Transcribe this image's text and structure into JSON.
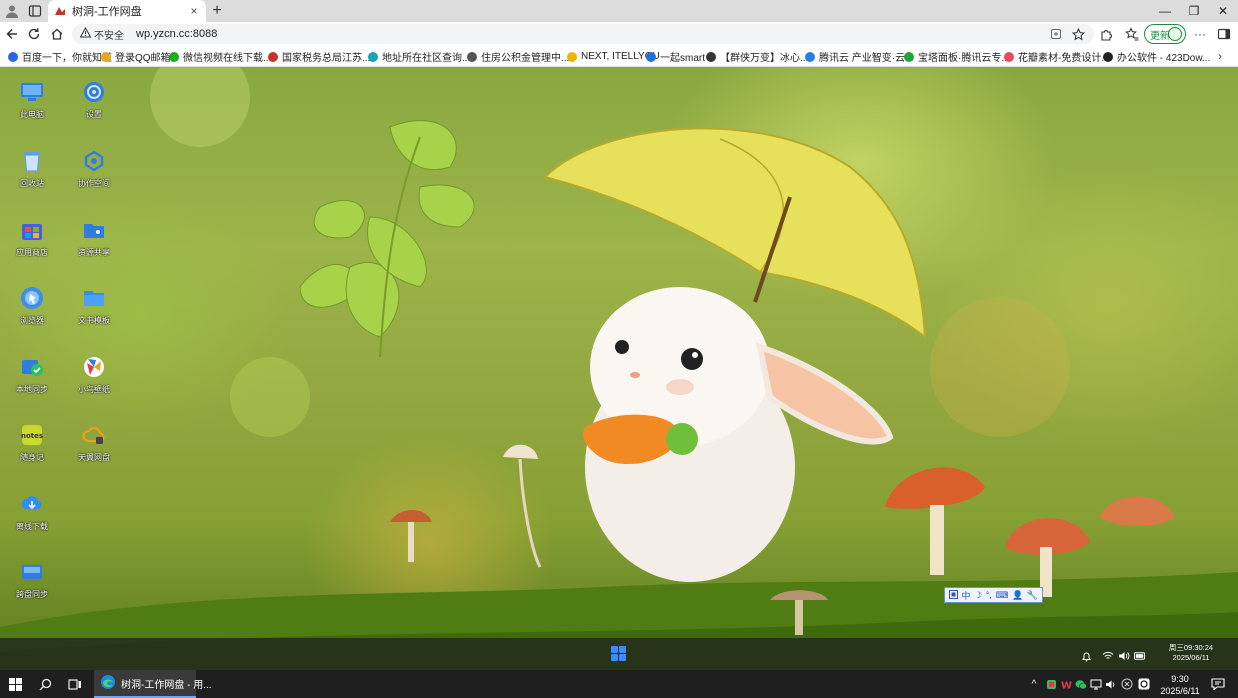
{
  "browser": {
    "tab": {
      "title": "树洞-工作网盘",
      "close_glyph": "×"
    },
    "new_tab_glyph": "+",
    "window_controls": {
      "minimize": "—",
      "restore": "❐",
      "close": "✕"
    },
    "address": {
      "security_label": "不安全",
      "url": "wp.yzcn.cc:8088"
    },
    "update_button": "更新",
    "menu_glyph": "···",
    "bookmarks": [
      {
        "label": "百度一下，你就知道",
        "color": "#2d63e6"
      },
      {
        "label": "登录QQ邮箱",
        "color": "#e8a61e"
      },
      {
        "label": "微信视频在线下载...",
        "color": "#1aad19"
      },
      {
        "label": "国家税务总局江苏...",
        "color": "#c8332b"
      },
      {
        "label": "地址所在社区查询...",
        "color": "#17a2b8"
      },
      {
        "label": "住房公积金管理中...",
        "color": "#555555"
      },
      {
        "label": "NEXT, ITELLYOU",
        "color": "#f0b400"
      },
      {
        "label": "一起smart",
        "color": "#1e73d8"
      },
      {
        "label": "【群侠万变】冰心...",
        "color": "#333333"
      },
      {
        "label": "腾讯云 产业智变·云...",
        "color": "#2b7de9"
      },
      {
        "label": "宝塔面板·腾讯云专...",
        "color": "#20a53a"
      },
      {
        "label": "花瓣素材-免费设计...",
        "color": "#e84b5f"
      },
      {
        "label": "办公软件 - 423Dow...",
        "color": "#222222"
      }
    ]
  },
  "desktop": {
    "icons": [
      {
        "label": "此电脑",
        "icon": "computer-icon",
        "color": "#2f7de1"
      },
      {
        "label": "设置",
        "icon": "gear-icon",
        "color": "#2f7de1"
      },
      {
        "label": "回收站",
        "icon": "recycle-bin-icon",
        "color": "#5aa0ea"
      },
      {
        "label": "协作空间",
        "icon": "collaboration-icon",
        "color": "#2f7de1"
      },
      {
        "label": "应用商店",
        "icon": "app-store-icon",
        "color": "#4a5ce6"
      },
      {
        "label": "资源共享",
        "icon": "share-folder-icon",
        "color": "#2f7de1"
      },
      {
        "label": "浏览器",
        "icon": "browser-icon",
        "color": "#3a8ef0"
      },
      {
        "label": "文书模板",
        "icon": "folder-icon",
        "color": "#2f8ef0"
      },
      {
        "label": "本地同步",
        "icon": "local-sync-icon",
        "color": "#2f7de1"
      },
      {
        "label": "小鸟壁纸",
        "icon": "bird-wallpaper-icon",
        "color": "#e13b3b"
      },
      {
        "label": "随身记",
        "icon": "notes-icon",
        "color": "#c9d92e"
      },
      {
        "label": "天翼网盘",
        "icon": "cloud-drive-icon",
        "color": "#f0a020"
      },
      {
        "label": "离线下载",
        "icon": "offline-download-icon",
        "color": "#2f8ef0"
      },
      {
        "label": "跨盘同步",
        "icon": "cross-drive-sync-icon",
        "color": "#2f7de1"
      }
    ],
    "inner_taskbar": {
      "clock_line1": "周三09:30:24",
      "clock_line2": "2025/06/11",
      "ime_items": [
        "中",
        "☽",
        "°,",
        "⌨",
        "👤",
        "🔧"
      ]
    }
  },
  "taskbar": {
    "app_label": "树洞-工作网盘 - 用...",
    "time": "9:30",
    "date": "2025/6/11",
    "tray_expand_glyph": "^"
  }
}
